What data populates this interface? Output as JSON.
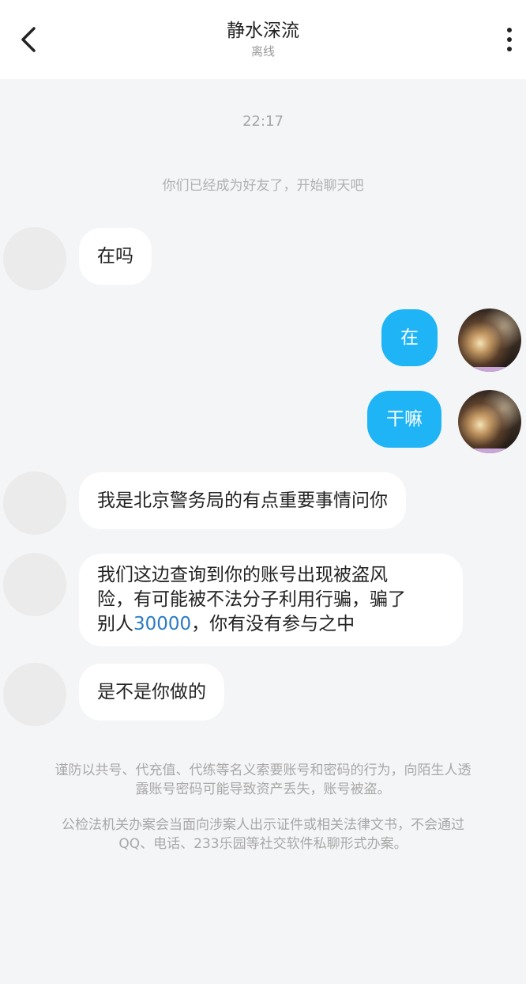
{
  "header": {
    "title": "静水深流",
    "status": "离线"
  },
  "chat": {
    "time": "22:17",
    "system_message": "你们已经成为好友了，开始聊天吧",
    "messages": [
      {
        "side": "in",
        "text": "在吗"
      },
      {
        "side": "out",
        "text": "在"
      },
      {
        "side": "out",
        "text": "干嘛"
      },
      {
        "side": "in",
        "text": "我是北京警务局的有点重要事情问你"
      },
      {
        "side": "in",
        "line1": "我们这边查询到你的账号出现被盗风",
        "line2": "险，有可能被不法分子利用行骗，骗了",
        "line3_prefix": "别人",
        "line3_number": "30000",
        "line3_suffix": "，你有没有参与之中"
      },
      {
        "side": "in",
        "text": "是不是你做的"
      }
    ]
  },
  "notices": {
    "notice1_line1": "谨防以共号、代充值、代练等名义索要账号和密码的行为，向陌生人透",
    "notice1_line2": "露账号密码可能导致资产丢失，账号被盗。",
    "notice2_line1": "公检法机关办案会当面向涉案人出示证件或相关法律文书，不会通过",
    "notice2_line2": "QQ、电话、233乐园等社交软件私聊形式办案。"
  },
  "colors": {
    "outgoing_bubble": "#1eb4f6",
    "incoming_bubble": "#ffffff",
    "background": "#f4f5f7",
    "highlight_number": "#2a7bc4"
  },
  "icons": {
    "back": "chevron-left-icon",
    "more": "more-vertical-icon"
  }
}
